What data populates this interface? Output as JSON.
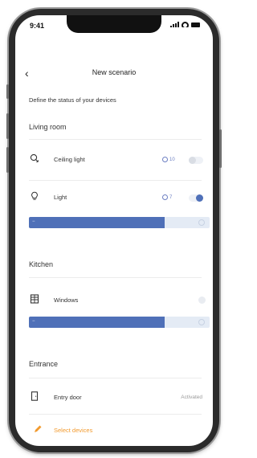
{
  "status_bar": {
    "time": "9:41"
  },
  "header": {
    "title": "New scenario"
  },
  "subtitle": "Define the status of your devices",
  "sections": {
    "living_room": "Living room",
    "kitchen": "Kitchen",
    "entrance": "Entrance"
  },
  "devices": {
    "ceiling_light": {
      "label": "Ceiling light",
      "timer": "10",
      "on": false
    },
    "light": {
      "label": "Light",
      "timer": "7",
      "on": true,
      "level": 0.75
    },
    "windows": {
      "label": "Windows",
      "level": 0.75
    },
    "entry_door": {
      "label": "Entry door",
      "status": "Activated"
    }
  },
  "footer": {
    "select_label": "Select devices"
  },
  "colors": {
    "accent_blue": "#4f70b8",
    "accent_orange": "#f29a2e"
  }
}
